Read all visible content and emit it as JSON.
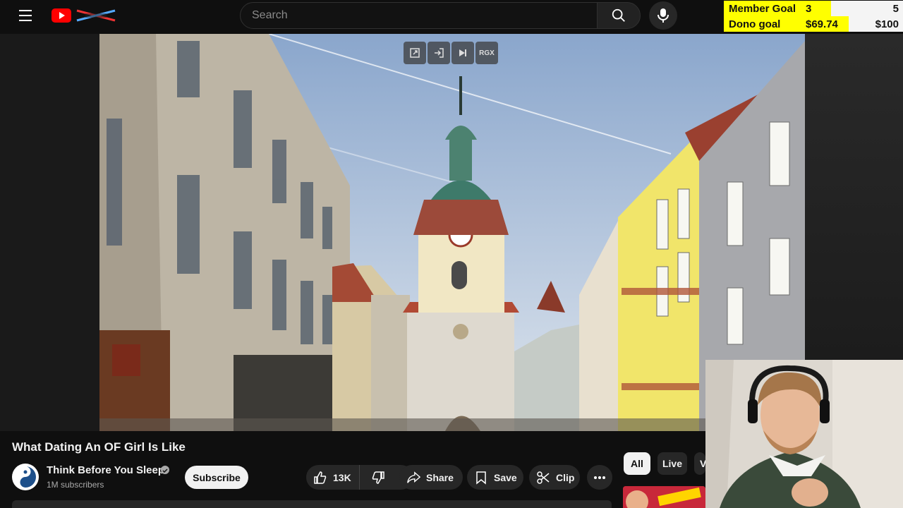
{
  "search": {
    "placeholder": "Search"
  },
  "goals": [
    {
      "label": "Member Goal",
      "current": "3",
      "target": "5",
      "progress": 0.6
    },
    {
      "label": "Dono goal",
      "current": "$69.74",
      "target": "$100",
      "progress": 0.6974
    }
  ],
  "player_controls": [
    "popout-icon",
    "enter-icon",
    "skip-next-icon",
    "RGX"
  ],
  "video": {
    "title": "What Dating An OF Girl Is Like"
  },
  "channel": {
    "name": "Think Before You Sleep",
    "subscribers": "1M subscribers"
  },
  "actions": {
    "subscribe": "Subscribe",
    "likes": "13K",
    "share": "Share",
    "save": "Save",
    "clip": "Clip"
  },
  "chips": [
    "All",
    "Live",
    "V"
  ],
  "colors": {
    "brand_red": "#ff0000",
    "goal_yellow": "#ffff00",
    "background": "#0f0f0f"
  }
}
